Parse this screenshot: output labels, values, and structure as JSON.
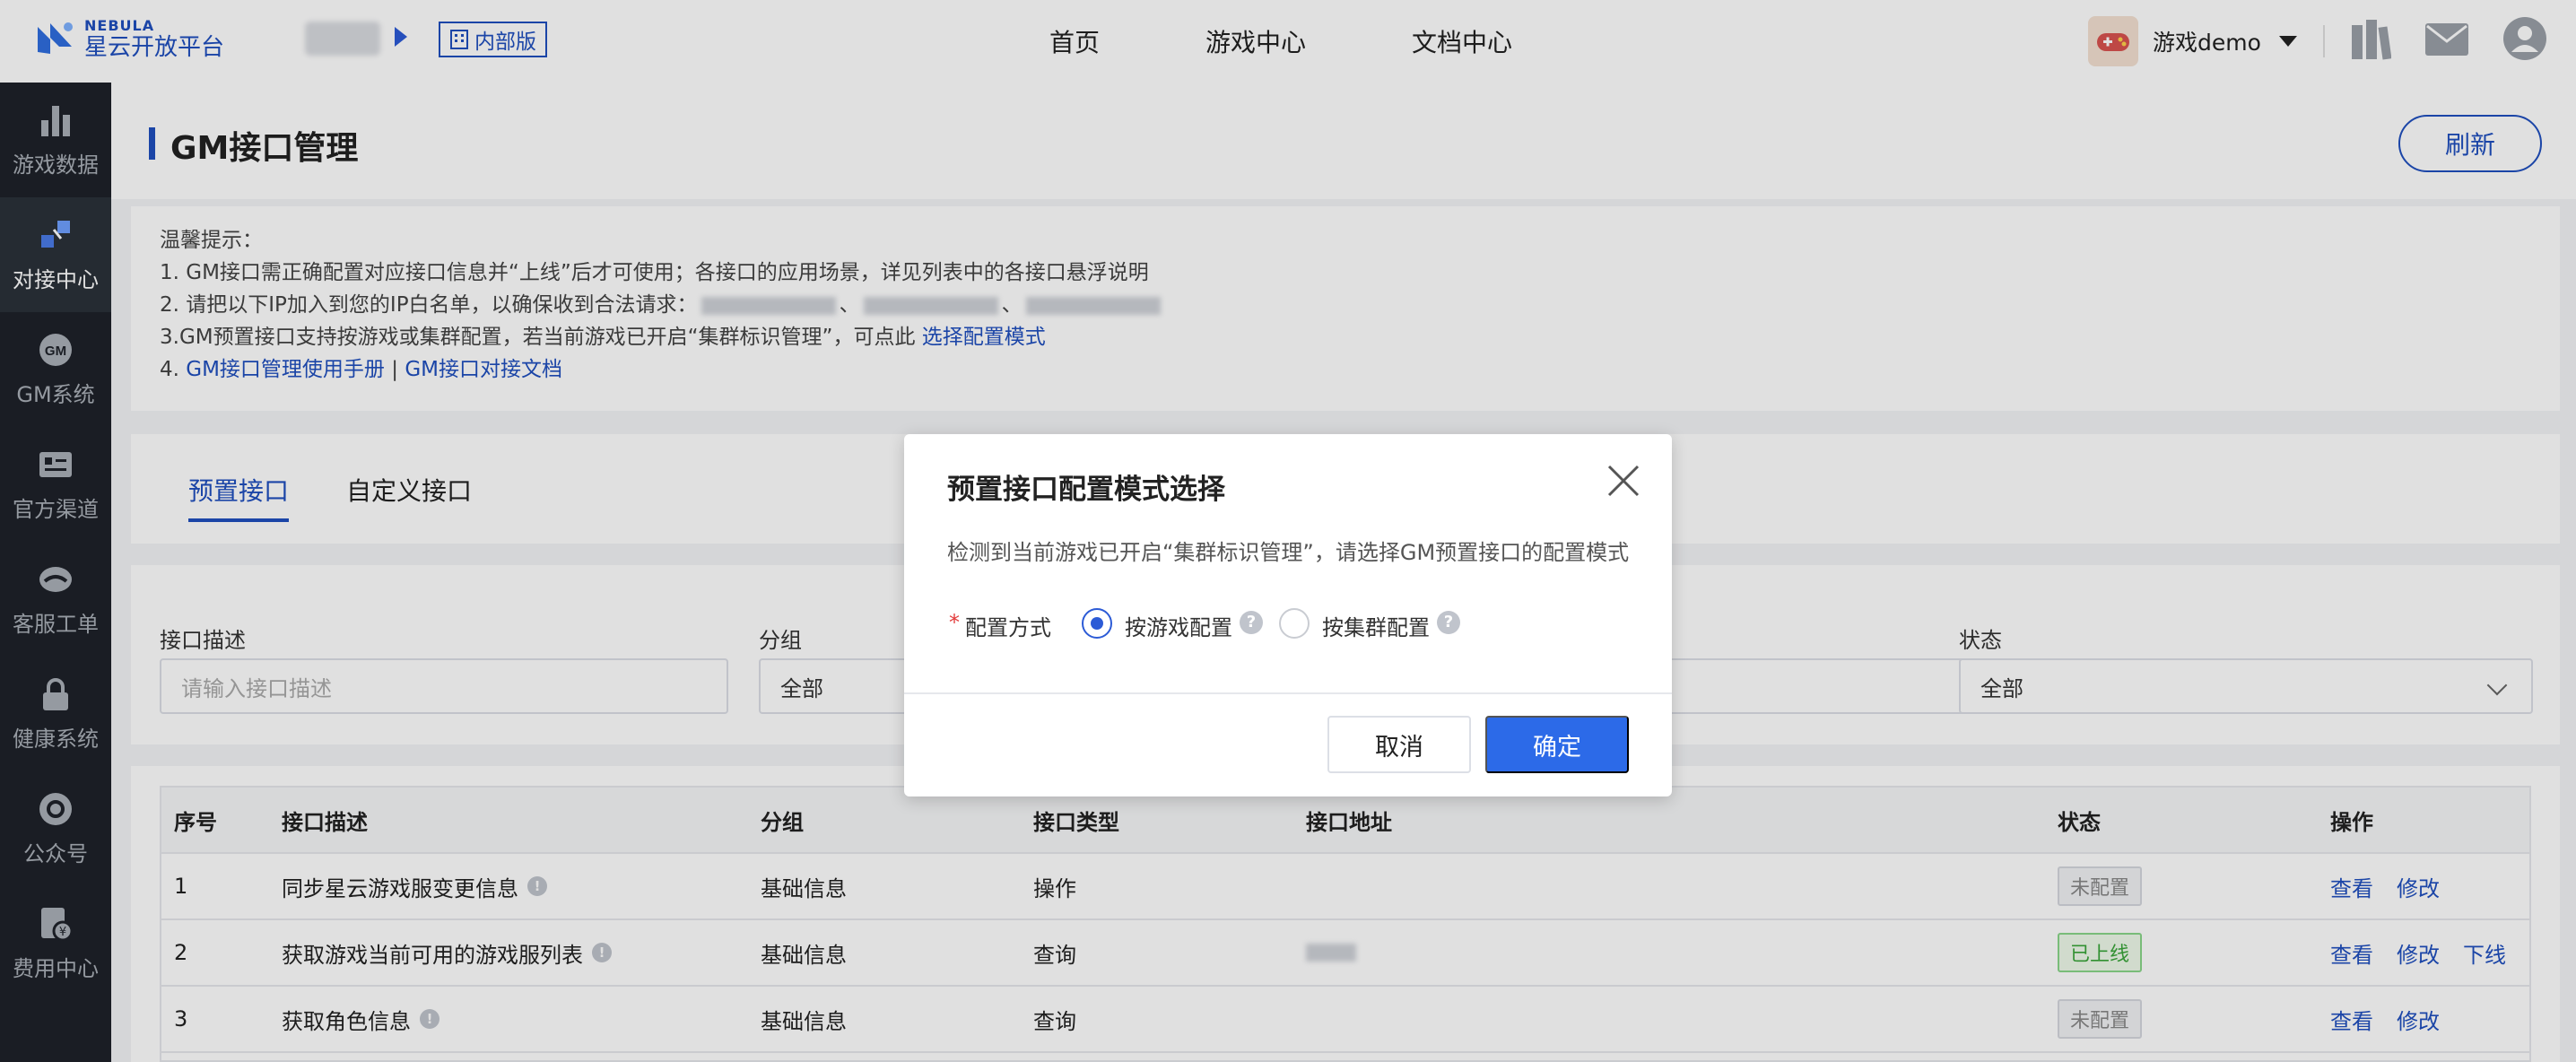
{
  "brand": {
    "en": "NEBULA",
    "zh": "星云开放平台"
  },
  "header": {
    "internal_badge": "内部版",
    "nav": [
      "首页",
      "游戏中心",
      "文档中心"
    ],
    "user_name": "游戏demo"
  },
  "sidebar": {
    "items": [
      {
        "label": "游戏数据",
        "icon": "bar-chart-icon"
      },
      {
        "label": "对接中心",
        "icon": "connect-icon",
        "active": true
      },
      {
        "label": "GM系统",
        "icon": "gm-icon"
      },
      {
        "label": "官方渠道",
        "icon": "channel-card-icon"
      },
      {
        "label": "客服工单",
        "icon": "service-icon"
      },
      {
        "label": "健康系统",
        "icon": "lock-icon"
      },
      {
        "label": "公众号",
        "icon": "official-account-icon"
      },
      {
        "label": "费用中心",
        "icon": "billing-icon"
      }
    ]
  },
  "page": {
    "title": "GM接口管理",
    "refresh": "刷新"
  },
  "tips": {
    "heading": "温馨提示：",
    "line1": "1. GM接口需正确配置对应接口信息并“上线”后才可使用；各接口的应用场景，详见列表中的各接口悬浮说明",
    "line2_prefix": "2. 请把以下IP加入到您的IP白名单，以确保收到合法请求：",
    "line2_sep": "、",
    "line3_prefix": "3.GM预置接口支持按游戏或集群配置，若当前游戏已开启“集群标识管理”，可点此 ",
    "line3_link": "选择配置模式",
    "line4_prefix": "4. ",
    "line4_link1": "GM接口管理使用手册",
    "line4_sep": " | ",
    "line4_link2": "GM接口对接文档"
  },
  "tabs": [
    "预置接口",
    "自定义接口"
  ],
  "filters": {
    "desc_label": "接口描述",
    "desc_placeholder": "请输入接口描述",
    "group_label": "分组",
    "group_value": "全部",
    "status_label": "状态",
    "status_value": "全部"
  },
  "table": {
    "columns": [
      "序号",
      "接口描述",
      "分组",
      "接口类型",
      "接口地址",
      "状态",
      "操作"
    ],
    "rows": [
      {
        "no": "1",
        "desc": "同步星云游戏服变更信息",
        "group": "基础信息",
        "type": "操作",
        "status": "未配置",
        "ops": [
          "查看",
          "修改"
        ]
      },
      {
        "no": "2",
        "desc": "获取游戏当前可用的游戏服列表",
        "group": "基础信息",
        "type": "查询",
        "status": "已上线",
        "ops": [
          "查看",
          "修改",
          "下线"
        ]
      },
      {
        "no": "3",
        "desc": "获取角色信息",
        "group": "基础信息",
        "type": "查询",
        "status": "未配置",
        "ops": [
          "查看",
          "修改"
        ]
      }
    ]
  },
  "modal": {
    "title": "预置接口配置模式选择",
    "desc": "检测到当前游戏已开启“集群标识管理”，请选择GM预置接口的配置模式",
    "required_mark": "*",
    "field_label": "配置方式",
    "option1": "按游戏配置",
    "option2": "按集群配置",
    "selected": "按游戏配置",
    "cancel": "取消",
    "ok": "确定"
  },
  "colors": {
    "primary": "#1f4fbf",
    "button": "#2c6ae8",
    "sidebar": "#1e2229",
    "online": "#3aa53a"
  }
}
